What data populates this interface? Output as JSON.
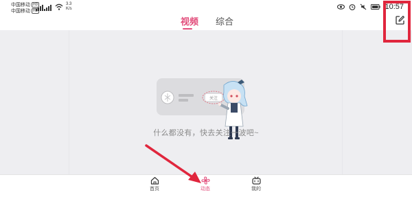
{
  "status_bar": {
    "carrier_1": "中国移动",
    "carrier_2": "中国移动",
    "hd_1": "HD",
    "hd_2": "HD",
    "net_speed_value": "3.3",
    "net_speed_unit": "K/s",
    "time": "10:57",
    "icons": [
      "signal-icon",
      "wifi-icon",
      "eye-icon",
      "alarm-icon",
      "mute-icon",
      "battery-icon"
    ]
  },
  "header": {
    "tabs": [
      {
        "label": "视频",
        "active": true
      },
      {
        "label": "综合",
        "active": false
      }
    ],
    "edit_icon": "edit-icon",
    "accent_color": "#e24d7b"
  },
  "empty_state": {
    "follow_chip": "关注",
    "message": "什么都没有，快去关注一波吧~"
  },
  "bottom_nav": [
    {
      "label": "首页",
      "icon": "home-icon",
      "active": false
    },
    {
      "label": "动态",
      "icon": "pinwheel-icon",
      "active": true
    },
    {
      "label": "我的",
      "icon": "tv-icon",
      "active": false
    }
  ],
  "annotation": {
    "color": "#e0263d"
  }
}
